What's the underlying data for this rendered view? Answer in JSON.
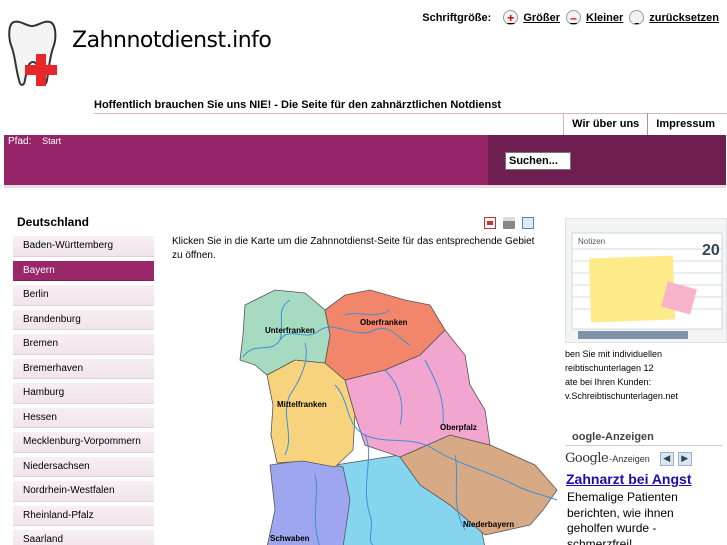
{
  "site": {
    "name": "Zahnnotdienst.info"
  },
  "font_tools": {
    "label": "Schriftgröße:",
    "bigger": "Größer",
    "smaller": "Kleiner",
    "reset": "zurücksetzen"
  },
  "tagline": "Hoffentlich brauchen Sie uns NIE! - Die Seite für den zahnärztlichen Notdienst",
  "topnav": [
    "Wir über uns",
    "Impressum"
  ],
  "breadcrumb": {
    "label": "Pfad:",
    "home": "Start"
  },
  "search": {
    "label": "Suchen..."
  },
  "sidebar": {
    "title": "Deutschland",
    "states": [
      "Baden-Württemberg",
      "Bayern",
      "Berlin",
      "Brandenburg",
      "Bremen",
      "Bremerhaven",
      "Hamburg",
      "Hessen",
      "Mecklenburg-Vorpommern",
      "Niedersachsen",
      "Nordrhein-Westfalen",
      "Rheinland-Pfalz",
      "Saarland"
    ],
    "active": "Bayern"
  },
  "main": {
    "intro": "Klicken Sie in die Karte um die Zahnnotdienst-Seite für das entsprechende Gebiet zu öffnen.",
    "regions": [
      "Unterfranken",
      "Oberfranken",
      "Mittelfranken",
      "Oberpfalz",
      "Niederbayern",
      "Schwaben"
    ],
    "colors": {
      "Unterfranken": "#a6dbc1",
      "Oberfranken": "#f2866a",
      "Mittelfranken": "#f7d37d",
      "Oberpfalz": "#f1a5cf",
      "Niederbayern": "#d7a985",
      "Schwaben": "#9ea6ef",
      "Oberbayern": "#86d5ef",
      "rivers": "#3f8fd9"
    }
  },
  "right": {
    "ad_image_caption": "Notizen",
    "ad_image_year": "20",
    "ad_text": [
      "ben Sie mit individuellen",
      "reibtischunterlagen 12",
      "ate bei Ihren Kunden:",
      "v.Schreibtischunterlagen.net"
    ],
    "google_title": "oogle-Anzeigen",
    "google_logo": "Google",
    "google_label": "-Anzeigen",
    "ad_headline": "Zahnarzt bei Angst",
    "ad_description": "Ehemalige Patienten berichten, wie ihnen geholfen wurde - schmerzfrei!"
  }
}
